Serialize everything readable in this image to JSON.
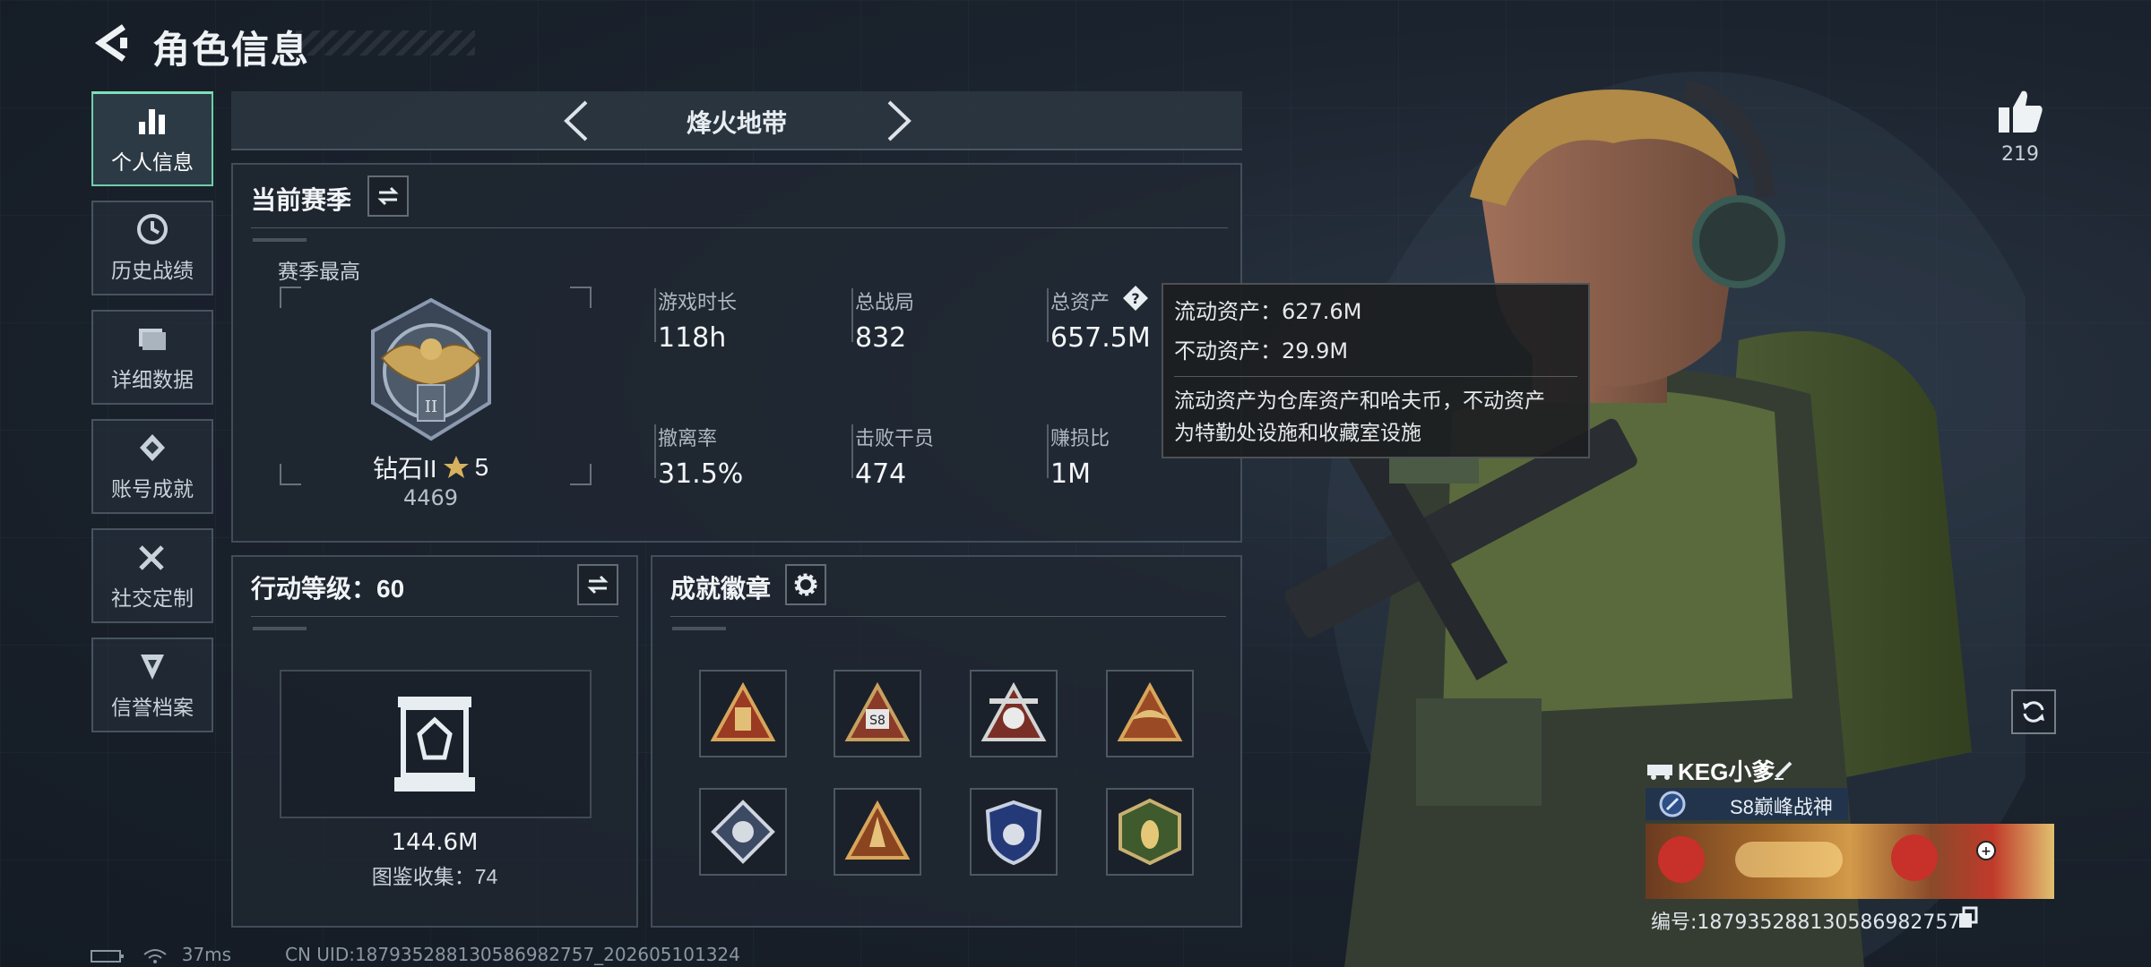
{
  "header": {
    "title": "角色信息"
  },
  "sidebar": {
    "items": [
      {
        "label": "个人信息",
        "icon": "bar-chart-icon",
        "active": true
      },
      {
        "label": "历史战绩",
        "icon": "history-icon",
        "active": false
      },
      {
        "label": "详细数据",
        "icon": "folder-icon",
        "active": false
      },
      {
        "label": "账号成就",
        "icon": "achievement-icon",
        "active": false
      },
      {
        "label": "社交定制",
        "icon": "tools-icon",
        "active": false
      },
      {
        "label": "信誉档案",
        "icon": "credit-icon",
        "active": false
      }
    ]
  },
  "mode": {
    "title": "烽火地带"
  },
  "season": {
    "title": "当前赛季",
    "best_label": "赛季最高",
    "rank_name": "钻石II",
    "rank_stars": "5",
    "rank_score": "4469",
    "stats": [
      {
        "label": "游戏时长",
        "value": "118h"
      },
      {
        "label": "总战局",
        "value": "832"
      },
      {
        "label": "总资产",
        "value": "657.5M"
      },
      {
        "label": "撤离率",
        "value": "31.5%"
      },
      {
        "label": "击败干员",
        "value": "474"
      },
      {
        "label": "赚损比",
        "value": "1M"
      }
    ]
  },
  "tooltip": {
    "liquid": "流动资产：627.6M",
    "fixed": "不动资产：29.9M",
    "desc_line1": "流动资产为仓库资产和哈夫币，不动资产",
    "desc_line2": "为特勤处设施和收藏室设施"
  },
  "action_level": {
    "title": "行动等级：60",
    "value": "144.6M",
    "collection": "图鉴收集：74"
  },
  "achievements": {
    "title": "成就徽章"
  },
  "social": {
    "likes": "219",
    "player_name": "KEG小爹",
    "player_title": "S8巅峰战神",
    "player_id": "编号:187935288130586982757"
  },
  "footer": {
    "ping": "37ms",
    "uid": "CN UID:187935288130586982757_202605101324"
  },
  "colors": {
    "accent": "#7fe0b8",
    "gold": "#c8a45a"
  }
}
